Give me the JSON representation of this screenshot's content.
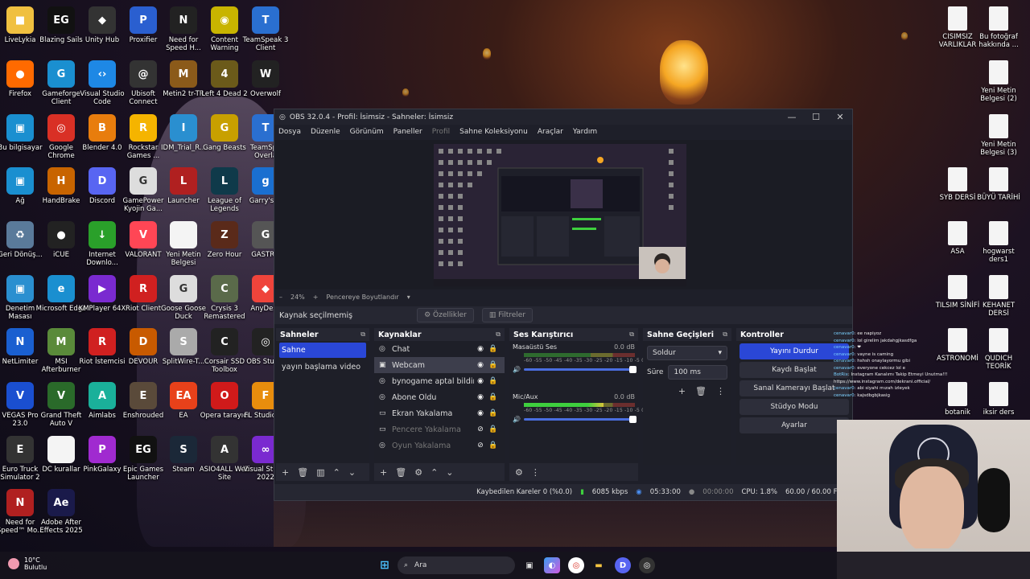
{
  "desktop": {
    "icons": [
      {
        "label": "LiveLykia",
        "glyph": "■",
        "color": "#f0c040"
      },
      {
        "label": "Blazing Sails",
        "glyph": "EG",
        "color": "#111111"
      },
      {
        "label": "Unity Hub",
        "glyph": "◆",
        "color": "#333333"
      },
      {
        "label": "Proxifier",
        "glyph": "P",
        "color": "#2a5fd0"
      },
      {
        "label": "Need for Speed H...",
        "glyph": "N",
        "color": "#222222"
      },
      {
        "label": "Content Warning",
        "glyph": "◉",
        "color": "#c8b400"
      },
      {
        "label": "TeamSpeak 3 Client",
        "glyph": "T",
        "color": "#2a6fd0"
      },
      {
        "label": "Firefox",
        "glyph": "●",
        "color": "#ff6a00"
      },
      {
        "label": "Gameforge Client",
        "glyph": "G",
        "color": "#1a8fd0"
      },
      {
        "label": "Visual Studio Code",
        "glyph": "‹›",
        "color": "#1e88e5"
      },
      {
        "label": "Ubisoft Connect",
        "glyph": "@",
        "color": "#333333"
      },
      {
        "label": "Metin2 tr-TR",
        "glyph": "M",
        "color": "#8b5a1a"
      },
      {
        "label": "Left 4 Dead 2",
        "glyph": "4",
        "color": "#6b5a1a"
      },
      {
        "label": "Overwolf",
        "glyph": "W",
        "color": "#222222"
      },
      {
        "label": "Bu bilgisayar",
        "glyph": "▣",
        "color": "#1a8fd0"
      },
      {
        "label": "Google Chrome",
        "glyph": "◎",
        "color": "#d93025"
      },
      {
        "label": "Blender 4.0",
        "glyph": "B",
        "color": "#e87d0d"
      },
      {
        "label": "Rockstar Games ...",
        "glyph": "R",
        "color": "#f5b400"
      },
      {
        "label": "IDM_Trial_R...",
        "glyph": "I",
        "color": "#2a8fd0"
      },
      {
        "label": "Gang Beasts",
        "glyph": "G",
        "color": "#c8a000"
      },
      {
        "label": "TeamSpe Overla",
        "glyph": "T",
        "color": "#2a6fd0"
      },
      {
        "label": "Ağ",
        "glyph": "▣",
        "color": "#1a8fd0"
      },
      {
        "label": "HandBrake",
        "glyph": "H",
        "color": "#c86400"
      },
      {
        "label": "Discord",
        "glyph": "D",
        "color": "#5865f2"
      },
      {
        "label": "GamePower Kyojin Ga...",
        "glyph": "G",
        "color": "#dddddd"
      },
      {
        "label": "Launcher",
        "glyph": "L",
        "color": "#b02020"
      },
      {
        "label": "League of Legends",
        "glyph": "L",
        "color": "#0f3a4a"
      },
      {
        "label": "Garry's M",
        "glyph": "g",
        "color": "#1a6fd0"
      },
      {
        "label": "Geri Dönüş...",
        "glyph": "♻",
        "color": "#5a7a9a"
      },
      {
        "label": "iCUE",
        "glyph": "●",
        "color": "#222222"
      },
      {
        "label": "Internet Downlo...",
        "glyph": "↓",
        "color": "#2aa02a"
      },
      {
        "label": "VALORANT",
        "glyph": "V",
        "color": "#ff4655"
      },
      {
        "label": "Yeni Metin Belgesi",
        "glyph": "",
        "color": "#f4f4f4"
      },
      {
        "label": "Zero Hour",
        "glyph": "Z",
        "color": "#5a2a1a"
      },
      {
        "label": "GASTRO",
        "glyph": "G",
        "color": "#555555"
      },
      {
        "label": "Denetim Masası",
        "glyph": "▣",
        "color": "#2a8fd0"
      },
      {
        "label": "Microsoft Edge",
        "glyph": "e",
        "color": "#1a8fd0"
      },
      {
        "label": "KMPlayer 64X",
        "glyph": "▶",
        "color": "#7a2ad0"
      },
      {
        "label": "Riot Client",
        "glyph": "R",
        "color": "#d02020"
      },
      {
        "label": "Goose Goose Duck",
        "glyph": "G",
        "color": "#dddddd"
      },
      {
        "label": "Crysis 3 Remastered",
        "glyph": "C",
        "color": "#5a6a4a"
      },
      {
        "label": "AnyDesk",
        "glyph": "◆",
        "color": "#ef443b"
      },
      {
        "label": "NetLimiter",
        "glyph": "N",
        "color": "#1a5fd0"
      },
      {
        "label": "MSI Afterburner",
        "glyph": "M",
        "color": "#5a8a3a"
      },
      {
        "label": "Riot İstemcisi",
        "glyph": "R",
        "color": "#d02020"
      },
      {
        "label": "DEVOUR",
        "glyph": "D",
        "color": "#c85a00"
      },
      {
        "label": "SplitWire-T...",
        "glyph": "S",
        "color": "#aaaaaa"
      },
      {
        "label": "Corsair SSD Toolbox",
        "glyph": "C",
        "color": "#222222"
      },
      {
        "label": "OBS Studio",
        "glyph": "◎",
        "color": "#222222"
      },
      {
        "label": "VEGAS Pro 23.0",
        "glyph": "V",
        "color": "#1a4fd0"
      },
      {
        "label": "Grand Theft Auto V",
        "glyph": "V",
        "color": "#2a6a2a"
      },
      {
        "label": "Aimlabs",
        "glyph": "A",
        "color": "#1ab09a"
      },
      {
        "label": "Enshrouded",
        "glyph": "E",
        "color": "#5a4a3a"
      },
      {
        "label": "EA",
        "glyph": "EA",
        "color": "#e8411a"
      },
      {
        "label": "Opera tarayıcı",
        "glyph": "O",
        "color": "#d01a1a"
      },
      {
        "label": "FL Studio 21",
        "glyph": "F",
        "color": "#e88d0d"
      },
      {
        "label": "Euro Truck Simulator 2",
        "glyph": "E",
        "color": "#333333"
      },
      {
        "label": "DC kurallar",
        "glyph": "",
        "color": "#f4f4f4"
      },
      {
        "label": "PinkGalaxy",
        "glyph": "P",
        "color": "#a02ad0"
      },
      {
        "label": "Epic Games Launcher",
        "glyph": "EG",
        "color": "#111111"
      },
      {
        "label": "Steam",
        "glyph": "S",
        "color": "#1b2838"
      },
      {
        "label": "ASIO4ALL Web Site",
        "glyph": "A",
        "color": "#333333"
      },
      {
        "label": "Visual Studio 2022",
        "glyph": "∞",
        "color": "#7a2ad0"
      },
      {
        "label": "Need for Speed™ Mo...",
        "glyph": "N",
        "color": "#b02020"
      },
      {
        "label": "Adobe After Effects 2025",
        "glyph": "Ae",
        "color": "#1a1a4a"
      }
    ],
    "right_icons": [
      {
        "label": "CISIMSIZ VARLIKLAR"
      },
      {
        "label": "Bu fotoğraf hakkında ..."
      },
      {
        "label": "Yeni Metin Belgesi (2)"
      },
      {
        "label": "Yeni Metin Belgesi (3)"
      },
      {
        "label": "SYB DERSİ"
      },
      {
        "label": "BÜYÜ TARİHİ"
      },
      {
        "label": "ASA"
      },
      {
        "label": "hogwarst ders1"
      },
      {
        "label": "TILSIM SİNİFİ"
      },
      {
        "label": "KEHANET DERSİ"
      },
      {
        "label": "ASTRONOMİ"
      },
      {
        "label": "QUDICH TEORİK"
      },
      {
        "label": "botanik"
      },
      {
        "label": "iksir ders"
      }
    ]
  },
  "obs": {
    "title": "OBS 32.0.4 - Profil: İsimsiz - Sahneler: İsimsiz",
    "menu": [
      "Dosya",
      "Düzenle",
      "Görünüm",
      "Paneller",
      "Profil",
      "Sahne Koleksiyonu",
      "Araçlar",
      "Yardım"
    ],
    "zoom": "24%",
    "zoom_mode": "Pencereye Boyutlandır",
    "no_source": "Kaynak seçilmemiş",
    "properties": "Özellikler",
    "filters": "Filtreler",
    "docks": {
      "scenes": {
        "title": "Sahneler",
        "items": [
          "Sahne",
          "yayın başlama video"
        ]
      },
      "sources": {
        "title": "Kaynaklar",
        "items": [
          {
            "name": "Chat",
            "icon": "◎",
            "hidden": false
          },
          {
            "name": "Webcam",
            "icon": "▣",
            "hidden": false
          },
          {
            "name": "bynogame aptal bildirtin",
            "icon": "◎",
            "hidden": false
          },
          {
            "name": "Abone Oldu",
            "icon": "◎",
            "hidden": false
          },
          {
            "name": "Ekran Yakalama",
            "icon": "▭",
            "hidden": false
          },
          {
            "name": "Pencere Yakalama",
            "icon": "▭",
            "hidden": true
          },
          {
            "name": "Oyun Yakalama",
            "icon": "◎",
            "hidden": true
          }
        ]
      },
      "mixer": {
        "title": "Ses Karıştırıcı",
        "ticks": "-60 -55 -50 -45 -40 -35 -30 -25 -20 -15 -10 -5 0",
        "channels": [
          {
            "name": "Masaüstü Ses",
            "db": "0.0 dB",
            "level": 0.0
          },
          {
            "name": "Mic/Aux",
            "db": "0.0 dB",
            "level": 0.72
          }
        ]
      },
      "transitions": {
        "title": "Sahne Geçişleri",
        "type": "Soldur",
        "duration_label": "Süre",
        "duration": "100 ms"
      },
      "controls": {
        "title": "Kontroller",
        "buttons": [
          "Yayını Durdur",
          "Kaydı Başlat",
          "Sanal Kamerayı Başlat",
          "Stüdyo Modu",
          "Ayarlar"
        ]
      }
    },
    "status": {
      "dropped": "Kaybedilen Kareler 0 (%0.0)",
      "bitrate": "6085 kbps",
      "stream_time": "05:33:00",
      "rec_time": "00:00:00",
      "cpu": "CPU: 1.8%",
      "fps": "60.00 / 60.00 FPS"
    }
  },
  "chat": [
    {
      "user": "cenavar0",
      "msg": ": ee napiyoz"
    },
    {
      "user": "cenavar0",
      "msg": ": lol girelim jakdahgjkasdfga"
    },
    {
      "user": "cenavar0",
      "msg": ": ❤"
    },
    {
      "user": "cenavar0",
      "msg": ": vayne is caming"
    },
    {
      "user": "cenavar0",
      "msg": ": hshsh onaylayormu gibi"
    },
    {
      "user": "cenavar0",
      "msg": ": everyone cekcez lol e"
    },
    {
      "user": "BotRix",
      "msg": ": Instagram Kanalımı Takip Etmeyi Unutma!!! https://www.instagram.com/dekrani.official/"
    },
    {
      "user": "cenavar0",
      "msg": ": abi siyahi mızah izleyek"
    },
    {
      "user": "cenavar0",
      "msg": ": kajsdbgbjkasig"
    }
  ],
  "taskbar": {
    "weather_temp": "10°C",
    "weather_desc": "Bulutlu",
    "search_placeholder": "Ara"
  }
}
